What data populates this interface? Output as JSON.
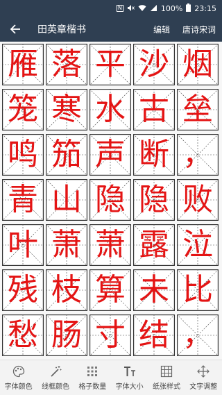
{
  "status_bar": {
    "nfc": "N",
    "mute": "🔇",
    "wifi": "wifi",
    "signal": "signal",
    "battery": "100%",
    "time": "23:15"
  },
  "app_bar": {
    "title": "田英章楷书",
    "edit_label": "编辑",
    "tang_poems_label": "唐诗宋词"
  },
  "characters": [
    "雁",
    "落",
    "平",
    "沙",
    "烟",
    "笼",
    "寒",
    "水",
    "古",
    "垒",
    "鸣",
    "笳",
    "声",
    "断",
    "，",
    "青",
    "山",
    "隐",
    "隐",
    "败",
    "叶",
    "萧",
    "萧",
    "露",
    "泣",
    "残",
    "枝",
    "算",
    "未",
    "比",
    "愁",
    "肠",
    "寸",
    "结",
    "，",
    "",
    "",
    "",
    "",
    ""
  ],
  "colors": {
    "ink": "#e41414",
    "header": "#2f3f52",
    "guide_solid": "#333333",
    "guide_dash": "#333333"
  },
  "toolbar": [
    {
      "label": "字体颜色",
      "icon": "palette-icon"
    },
    {
      "label": "线框颜色",
      "icon": "magic-wand-icon"
    },
    {
      "label": "格子数量",
      "icon": "grid-dots-icon"
    },
    {
      "label": "字体大小",
      "icon": "font-size-icon"
    },
    {
      "label": "纸张样式",
      "icon": "paper-grid-icon"
    },
    {
      "label": "文字调整",
      "icon": "move-arrows-icon"
    }
  ]
}
